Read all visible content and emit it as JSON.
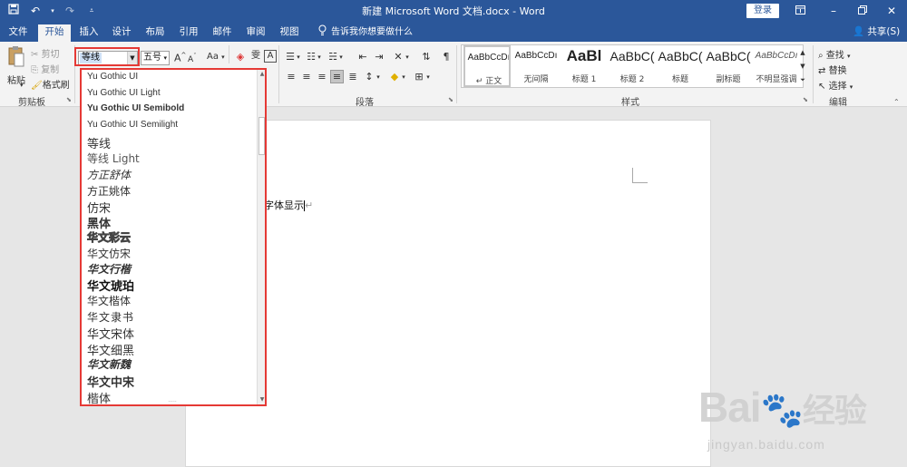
{
  "window": {
    "title": "新建 Microsoft Word 文档.docx  -  Word",
    "login_label": "登录",
    "controls": [
      "restore-ribbon",
      "minimize",
      "maximize",
      "close"
    ]
  },
  "qat": {
    "save_icon": "save-icon",
    "undo_icon": "undo-icon",
    "redo_icon": "redo-icon",
    "customize_icon": "customize-qat-icon"
  },
  "tabs": [
    {
      "label": "文件",
      "active": false
    },
    {
      "label": "开始",
      "active": true
    },
    {
      "label": "插入",
      "active": false
    },
    {
      "label": "设计",
      "active": false
    },
    {
      "label": "布局",
      "active": false
    },
    {
      "label": "引用",
      "active": false
    },
    {
      "label": "邮件",
      "active": false
    },
    {
      "label": "审阅",
      "active": false
    },
    {
      "label": "视图",
      "active": false
    }
  ],
  "tellme": {
    "placeholder": "告诉我你想要做什么"
  },
  "share_label": "共享(S)",
  "clipboard": {
    "paste": "粘贴",
    "cut": "剪切",
    "copy": "复制",
    "format_painter": "格式刷",
    "group_label": "剪贴板"
  },
  "font": {
    "current_font": "等线",
    "current_size": "五号",
    "grow_label": "A",
    "shrink_label": "A",
    "case_label": "Aa"
  },
  "paragraph": {
    "group_label": "段落"
  },
  "styles": {
    "group_label": "样式",
    "items": [
      {
        "sample": "AaBbCcDı",
        "name": "↵ 正文",
        "selected": true
      },
      {
        "sample": "AaBbCcDı",
        "name": "无间隔",
        "selected": false
      },
      {
        "sample": "AaBl",
        "name": "标题 1",
        "selected": false
      },
      {
        "sample": "AaBbC(",
        "name": "标题 2",
        "selected": false
      },
      {
        "sample": "AaBbC(",
        "name": "标题",
        "selected": false
      },
      {
        "sample": "AaBbC(",
        "name": "副标题",
        "selected": false
      },
      {
        "sample": "AaBbCcDı",
        "name": "不明显强调",
        "selected": false
      }
    ]
  },
  "editing": {
    "find": "查找",
    "replace": "替换",
    "select": "选择",
    "group_label": "编辑"
  },
  "font_dropdown": {
    "items": [
      "Yu Gothic UI",
      "Yu Gothic UI Light",
      "Yu Gothic UI Semibold",
      "Yu Gothic UI Semilight",
      "等线",
      "等线 Light",
      "方正舒体",
      "方正姚体",
      "仿宋",
      "黑体",
      "华文彩云",
      "华文仿宋",
      "华文行楷",
      "华文琥珀",
      "华文楷体",
      "华文隶书",
      "华文宋体",
      "华文细黑",
      "华文新魏",
      "华文中宋",
      "楷体"
    ]
  },
  "document": {
    "body_text": "字体显示"
  },
  "watermark": {
    "brand": "Bai",
    "brand2": "经验",
    "url": "jingyan.baidu.com"
  },
  "colors": {
    "accent": "#2b579a",
    "highlight_border": "#e53935"
  }
}
